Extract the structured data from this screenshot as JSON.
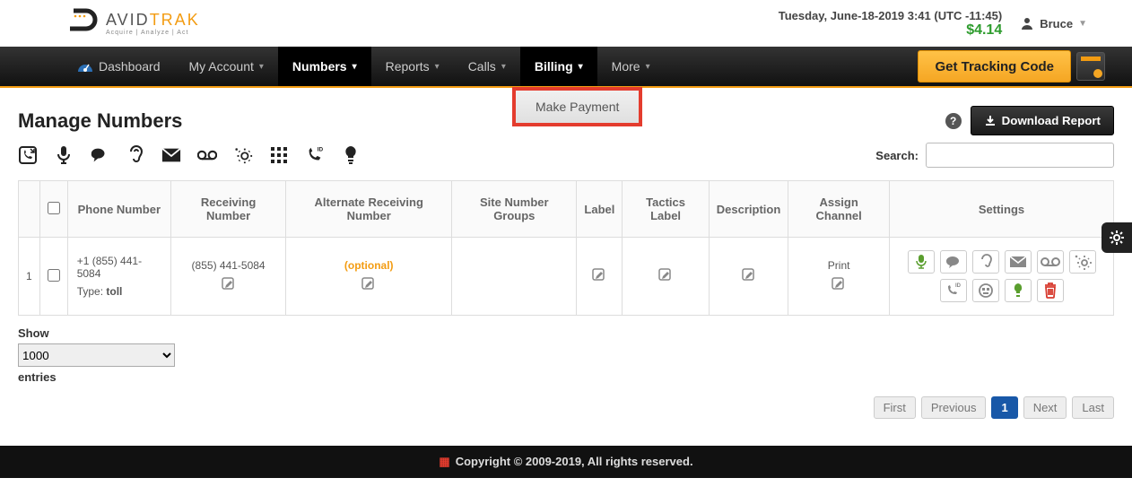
{
  "header": {
    "brand_main": "AVID",
    "brand_accent": "TRAK",
    "brand_sub": "Acquire | Analyze | Act",
    "datetime": "Tuesday, June-18-2019 3:41 (UTC -11:45)",
    "balance": "$4.14",
    "user_name": "Bruce"
  },
  "nav": {
    "dashboard": "Dashboard",
    "my_account": "My Account",
    "numbers": "Numbers",
    "reports": "Reports",
    "calls": "Calls",
    "billing": "Billing",
    "more": "More",
    "tracking_btn": "Get Tracking Code",
    "submenu_billing": "Make Payment"
  },
  "page": {
    "title": "Manage Numbers",
    "download_btn": "Download Report",
    "search_label": "Search:"
  },
  "table": {
    "headers": {
      "phone": "Phone Number",
      "receiving": "Receiving Number",
      "alt_receiving": "Alternate Receiving Number",
      "site_groups": "Site Number Groups",
      "label": "Label",
      "tactics": "Tactics Label",
      "description": "Description",
      "assign_channel": "Assign Channel",
      "settings": "Settings"
    },
    "rows": [
      {
        "idx": "1",
        "phone": "+1 (855) 441-5084",
        "type_label": "Type:",
        "type_value": "toll",
        "receiving": "(855) 441-5084",
        "alt_receiving": "(optional)",
        "assign_channel": "Print"
      }
    ]
  },
  "footer_controls": {
    "show_label": "Show",
    "show_value": "1000",
    "entries_label": "entries",
    "pager": {
      "first": "First",
      "prev": "Previous",
      "p1": "1",
      "next": "Next",
      "last": "Last"
    }
  },
  "footer": {
    "text": "Copyright © 2009-2019, All rights reserved."
  }
}
